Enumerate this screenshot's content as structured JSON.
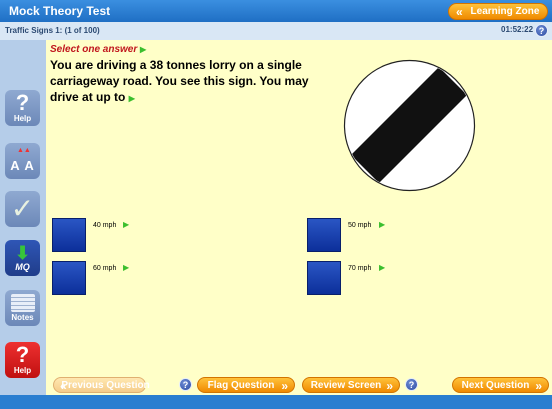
{
  "app": {
    "title": "Mock Theory Test",
    "learning_zone_label": "Learning Zone"
  },
  "info": {
    "question_counter": "Traffic Signs 1:  (1 of 100)",
    "timer": "01:52:22"
  },
  "sidebar": {
    "help_label": "Help",
    "aa_label": "A A",
    "mq_label": "MQ",
    "notes_label": "Notes",
    "help2_label": "Help"
  },
  "question": {
    "instruction": "Select one answer",
    "text": "You are driving a 38 tonnes lorry on a single carriageway road. You see this sign. You may drive at up to",
    "sign": "national-speed-limit-sign"
  },
  "answers": [
    {
      "label": "40 mph"
    },
    {
      "label": "50 mph"
    },
    {
      "label": "60 mph"
    },
    {
      "label": "70 mph"
    }
  ],
  "footer": {
    "previous_label": "Previous Question",
    "flag_label": "Flag Question",
    "review_label": "Review Screen",
    "next_label": "Next Question"
  },
  "colors": {
    "accent_orange": "#f5a01a",
    "header_blue": "#2a7ed0",
    "panel_yellow": "#ffffc8",
    "answer_blue": "#1442b0",
    "instruction_red": "#c0161d"
  }
}
